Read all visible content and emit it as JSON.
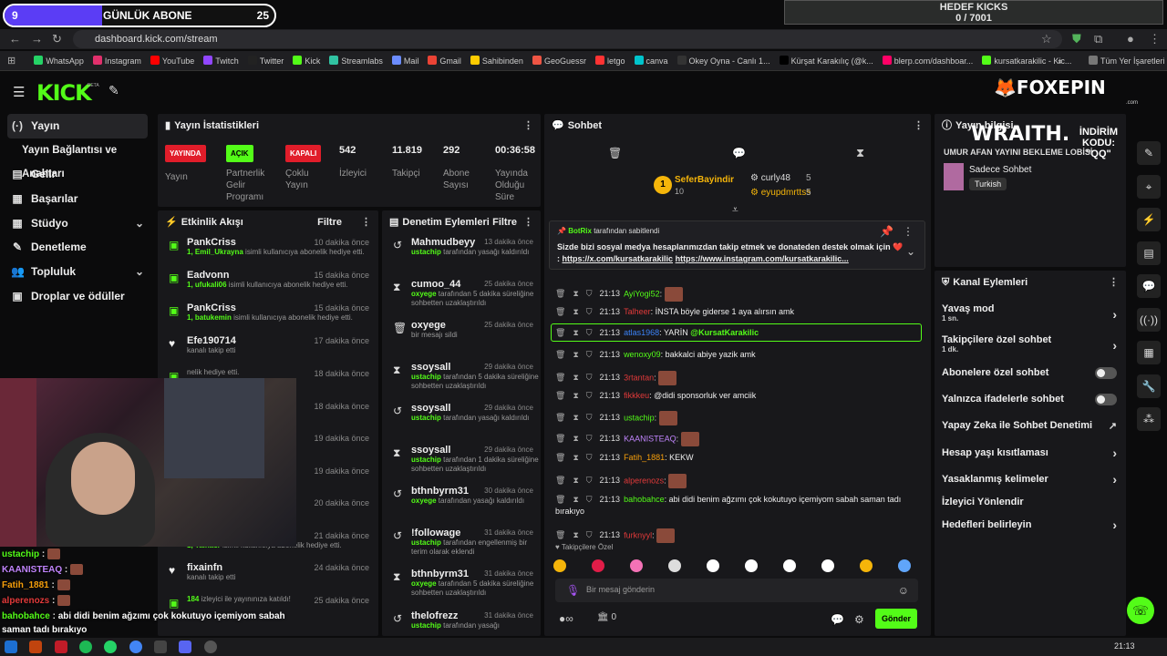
{
  "overlay": {
    "sub_goal": {
      "current": "9",
      "label": "GÜNLÜK ABONE",
      "target": "25",
      "progress": 0.36
    },
    "kick_goal": {
      "title": "HEDEF KICKS",
      "value": "0 / 7001"
    },
    "sponsor": {
      "brand": "FOXEPIN",
      "domain": ".com",
      "wraith": "WRAITH.",
      "promo_label": "İNDİRİM KODU:",
      "promo_code": "\"QQ\""
    }
  },
  "browser": {
    "url": "dashboard.kick.com/stream",
    "bookmarks": [
      "WhatsApp",
      "Instagram",
      "YouTube",
      "Twitch",
      "Twitter",
      "Kick",
      "Streamlabs",
      "Mail",
      "Gmail",
      "Sahibinden",
      "GeoGuessr",
      "letgo",
      "canva",
      "Okey Oyna - Canlı 1...",
      "Kürşat Karakılıç (@k...",
      "blerp.com/dashboar...",
      "kursatkarakilic - Kic..."
    ],
    "all_bookmarks": "Tüm Yer İşaretleri"
  },
  "header": {
    "logo": "KICK",
    "beta": "BETA"
  },
  "sidebar": {
    "items": [
      {
        "label": "Yayın",
        "icon": "(·)"
      },
      {
        "label": "Yayın Bağlantısı ve Anahtarı",
        "icon": ""
      },
      {
        "label": "Gelir",
        "icon": "▤"
      },
      {
        "label": "Başarılar",
        "icon": "▦"
      },
      {
        "label": "Stüdyo",
        "icon": "▦"
      },
      {
        "label": "Denetleme",
        "icon": "✎"
      },
      {
        "label": "Topluluk",
        "icon": "👥"
      },
      {
        "label": "Droplar ve ödüller",
        "icon": "▣"
      }
    ]
  },
  "stats": {
    "title": "Yayın İstatistikleri",
    "items": [
      {
        "tag": "YAYINDA",
        "label": "Yayın"
      },
      {
        "tag": "AÇIK",
        "label": "Partnerlik Gelir Programı"
      },
      {
        "tag": "KAPALI",
        "label": "Çoklu Yayın"
      },
      {
        "value": "542",
        "label": "İzleyici"
      },
      {
        "value": "11.819",
        "label": "Takipçi"
      },
      {
        "value": "292",
        "label": "Abone Sayısı"
      },
      {
        "value": "00:36:58",
        "label": "Yayında Olduğu Süre"
      }
    ]
  },
  "activity": {
    "title": "Etkinlik Akışı",
    "filter": "Filtre",
    "events": [
      {
        "name": "PankCriss",
        "time": "10 dakika önce",
        "detail_user": "1, Emil_Ukrayna",
        "detail": " isimli kullanıcıya abonelik hediye etti."
      },
      {
        "name": "Eadvonn",
        "time": "15 dakika önce",
        "detail_user": "1, ufukali06",
        "detail": " isimli kullanıcıya abonelik hediye etti."
      },
      {
        "name": "PankCriss",
        "time": "15 dakika önce",
        "detail_user": "1, batukemin",
        "detail": " isimli kullanıcıya abonelik hediye etti."
      },
      {
        "name": "Efe190714",
        "time": "17 dakika önce",
        "detail_user": "",
        "detail": "kanalı takip etti"
      },
      {
        "name": "",
        "time": "18 dakika önce",
        "detail_user": "",
        "detail": "nelik hediye etti."
      },
      {
        "name": "",
        "time": "18 dakika önce",
        "detail_user": "",
        "detail": "nelik hediye etti."
      },
      {
        "name": "",
        "time": "19 dakika önce",
        "detail_user": "",
        "detail": "nelik hediye etti."
      },
      {
        "name": "",
        "time": "19 dakika önce",
        "detail_user": "",
        "detail": ""
      },
      {
        "name": "",
        "time": "20 dakika önce",
        "detail_user": "",
        "detail": "nelik hediye etti."
      },
      {
        "name": "eyupdmrtss",
        "time": "21 dakika önce",
        "detail_user": "1, Talhacr",
        "detail": " isimli kullanıcıya abonelik hediye etti."
      },
      {
        "name": "fixainfn",
        "time": "24 dakika önce",
        "detail_user": "",
        "detail": "kanalı takip etti"
      },
      {
        "name": "",
        "time": "25 dakika önce",
        "detail_user": "184",
        "detail": " izleyici ile yayınınıza katıldı!"
      }
    ]
  },
  "moderation": {
    "title": "Denetim Eylemleri",
    "filter": "Filtre",
    "actions": [
      {
        "name": "Mahmudbeyy",
        "time": "13 dakika önce",
        "by": "ustachip",
        "detail": " tarafından yasağı kaldırıldı",
        "icon": "↺"
      },
      {
        "name": "cumoo_44",
        "time": "25 dakika önce",
        "by": "oxyege",
        "detail": " tarafından 5 dakika süreliğine sohbetten uzaklaştırıldı",
        "icon": "⧗"
      },
      {
        "name": "oxyege",
        "time": "25 dakika önce",
        "by": "",
        "detail": "bir mesajı sildi",
        "icon": "🗑"
      },
      {
        "name": "ssoysall",
        "time": "29 dakika önce",
        "by": "ustachip",
        "detail": " tarafından 5 dakika süreliğine sohbetten uzaklaştırıldı",
        "icon": "⧗"
      },
      {
        "name": "ssoysall",
        "time": "29 dakika önce",
        "by": "ustachip",
        "detail": " tarafından yasağı kaldırıldı",
        "icon": "↺"
      },
      {
        "name": "ssoysall",
        "time": "29 dakika önce",
        "by": "ustachip",
        "detail": " tarafından 1 dakika süreliğine sohbetten uzaklaştırıldı",
        "icon": "⧗"
      },
      {
        "name": "bthnbyrm31",
        "time": "30 dakika önce",
        "by": "oxyege",
        "detail": " tarafından yasağı kaldırıldı",
        "icon": "↺"
      },
      {
        "name": "!followage",
        "time": "31 dakika önce",
        "by": "ustachip",
        "detail": " tarafından engellenmiş bir terim olarak eklendi",
        "icon": "↺"
      },
      {
        "name": "bthnbyrm31",
        "time": "31 dakika önce",
        "by": "oxyege",
        "detail": " tarafından 5 dakika süreliğine sohbetten uzaklaştırıldı",
        "icon": "⧗"
      },
      {
        "name": "thelofrezz",
        "time": "31 dakika önce",
        "by": "ustachip",
        "detail": " tarafından yasağı",
        "icon": "↺"
      }
    ]
  },
  "chat": {
    "title": "Sohbet",
    "leaders": [
      {
        "rank": "1",
        "name": "SeferBayindir",
        "count": "10"
      },
      {
        "name": "curly48",
        "count": "5"
      },
      {
        "name": "eyupdmrttss",
        "count": "5"
      }
    ],
    "pinned": {
      "by": "BotRix",
      "by_suffix": " tarafından sabitlendi",
      "text": "Sizde bizi sosyal medya hesaplarımızdan takip etmek ve donateden destek olmak için ❤️ : ",
      "link1": "https://x.com/kursatkarakilic",
      "link2": "https://www.instagram.com/kursatkarakilic..."
    },
    "messages": [
      {
        "time": "21:13",
        "user": "AyiYogi52",
        "color": "#53fc18",
        "text": "",
        "emote": true
      },
      {
        "time": "21:13",
        "user": "Talheer",
        "color": "#e23a3a",
        "text": "İNSTA böyle giderse 1 aya alırsın amk",
        "emote": false
      },
      {
        "time": "21:13",
        "user": "atlas1968",
        "color": "#3b82f6",
        "text": "YARİN ",
        "mention": "@KursatKarakilic",
        "emote": false,
        "highlight": true
      },
      {
        "time": "21:13",
        "user": "wenoxy09",
        "color": "#53fc18",
        "text": "bakkalci abiye yazik amk",
        "emote": false
      },
      {
        "time": "21:13",
        "user": "3rtantan",
        "color": "#e23a3a",
        "text": "",
        "emote": true
      },
      {
        "time": "21:13",
        "user": "fikkkeu",
        "color": "#e23a3a",
        "text": "@didi sponsorluk ver amciik",
        "emote": false
      },
      {
        "time": "21:13",
        "user": "ustachip",
        "color": "#53fc18",
        "text": "",
        "emote": true
      },
      {
        "time": "21:13",
        "user": "KAANISTEAQ",
        "color": "#c084fc",
        "text": "",
        "emote": true
      },
      {
        "time": "21:13",
        "user": "Fatih_1881",
        "color": "#f59e0b",
        "text": "KEKW",
        "emote": false
      },
      {
        "time": "21:13",
        "user": "alperenozs",
        "color": "#e23a3a",
        "text": "",
        "emote": true
      },
      {
        "time": "21:13",
        "user": "bahobahce",
        "color": "#53fc18",
        "text": "abi didi benim ağzımı çok kokutuyo içemiyom sabah saman tadı",
        "text2": "bırakıyo",
        "emote": false
      },
      {
        "time": "21:13",
        "user": "furknyyl",
        "color": "#e23a3a",
        "text": "",
        "emote": true
      }
    ],
    "followers_only": "Takipçilere Özel",
    "input_placeholder": "Bir mesaj gönderin",
    "points": "0",
    "send": "Gönder"
  },
  "stream_info": {
    "title": "Yayın bilgisi",
    "stream_title": "UMUR AFAN YAYINI BEKLEME LOBİSİ",
    "category": "Sadece Sohbet",
    "language": "Turkish"
  },
  "channel_actions": {
    "title": "Kanal Eylemleri",
    "rows": [
      {
        "label": "Yavaş mod",
        "sub": "1 sn."
      },
      {
        "label": "Takipçilere özel sohbet",
        "sub": "1 dk."
      },
      {
        "label": "Abonelere özel sohbet"
      },
      {
        "label": "Yalnızca ifadelerle sohbet"
      },
      {
        "label": "Yapay Zeka ile Sohbet Denetimi"
      },
      {
        "label": "Hesap yaşı kısıtlaması"
      },
      {
        "label": "Yasaklanmış kelimeler"
      },
      {
        "label": "İzleyici Yönlendir"
      },
      {
        "label": "Hedefleri belirleyin"
      }
    ]
  },
  "cam_chat": [
    {
      "user": "ustachip",
      "color": "#53fc18",
      "text": ""
    },
    {
      "user": "KAANISTEAQ",
      "color": "#c084fc",
      "text": ""
    },
    {
      "user": "Fatih_1881",
      "color": "#f59e0b",
      "text": ""
    },
    {
      "user": "alperenozs",
      "color": "#e23a3a",
      "text": ""
    },
    {
      "user": "bahobahce",
      "color": "#53fc18",
      "text": "abi didi benim ağzımı çok kokutuyo içemiyom sabah",
      "text2": "saman tadı bırakıyo"
    }
  ],
  "taskbar": {
    "time": "21:13"
  }
}
